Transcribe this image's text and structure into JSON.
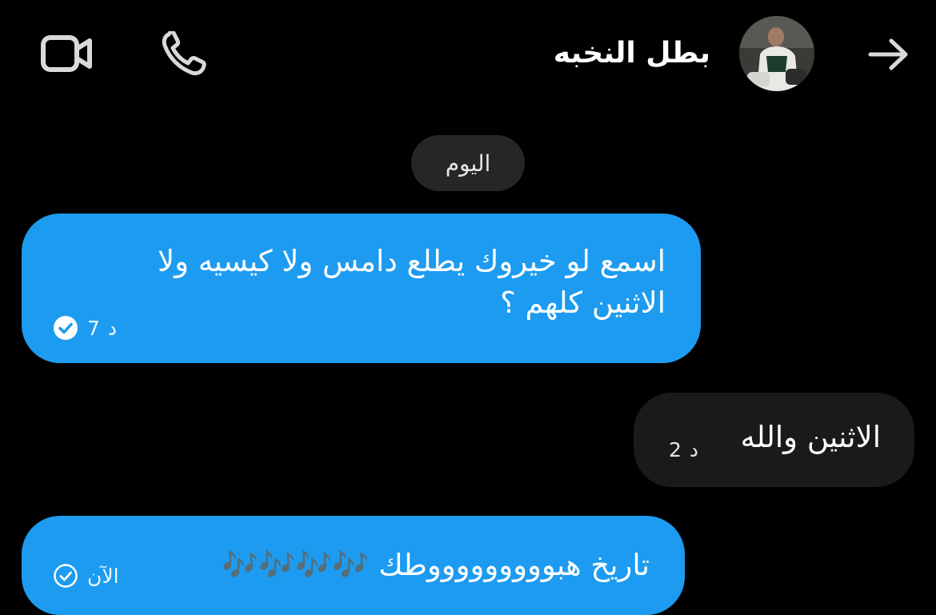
{
  "header": {
    "contact_name": "بطل النخبه",
    "video_icon": "video-camera-icon",
    "phone_icon": "phone-icon",
    "back_icon": "arrow-right-icon"
  },
  "date_separator": "اليوم",
  "messages": [
    {
      "direction": "outgoing",
      "lines": [
        "اسمع لو خيروك يطلع دامس ولا كيسيه ولا",
        "الاثنين كلهم ؟"
      ],
      "time_value": "7",
      "time_unit": "د",
      "status_icon": "read-check-icon"
    },
    {
      "direction": "incoming",
      "lines": [
        "الاثنين والله"
      ],
      "time_value": "2",
      "time_unit": "د"
    },
    {
      "direction": "outgoing",
      "lines": [
        "تاريخ هبوووووووووطك 🎶🎶🎶🎶"
      ],
      "time_label": "الآن",
      "status_icon": "sent-check-icon"
    }
  ],
  "colors": {
    "background": "#000000",
    "outgoing_bubble": "#1d9bf0",
    "incoming_bubble": "#1a1a1a",
    "date_chip": "#262626"
  }
}
